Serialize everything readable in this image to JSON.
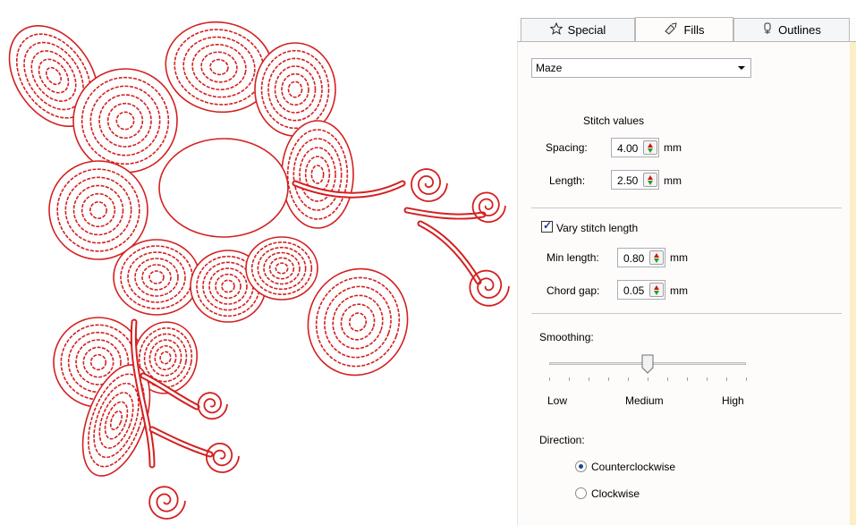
{
  "tabs": [
    {
      "label": "Special",
      "icon": "star-icon",
      "active": false
    },
    {
      "label": "Fills",
      "icon": "fill-brush-icon",
      "active": true
    },
    {
      "label": "Outlines",
      "icon": "outline-pen-icon",
      "active": false
    }
  ],
  "fill_type": {
    "selected": "Maze"
  },
  "stitch_values": {
    "heading": "Stitch values",
    "spacing": {
      "label": "Spacing:",
      "value": "4.00",
      "unit": "mm"
    },
    "length": {
      "label": "Length:",
      "value": "2.50",
      "unit": "mm"
    }
  },
  "vary": {
    "checkbox_label": "Vary stitch length",
    "checked": true,
    "min_length": {
      "label": "Min length:",
      "value": "0.80",
      "unit": "mm"
    },
    "chord_gap": {
      "label": "Chord gap:",
      "value": "0.05",
      "unit": "mm"
    }
  },
  "smoothing": {
    "label": "Smoothing:",
    "low": "Low",
    "medium": "Medium",
    "high": "High",
    "level": 0.5
  },
  "direction": {
    "label": "Direction:",
    "options": [
      {
        "label": "Counterclockwise",
        "selected": true
      },
      {
        "label": "Clockwise",
        "selected": false
      }
    ]
  },
  "colors": {
    "stitch": "#d42020",
    "panel_bg": "#fdfcfa",
    "edge_accent": "#fcefc4"
  }
}
